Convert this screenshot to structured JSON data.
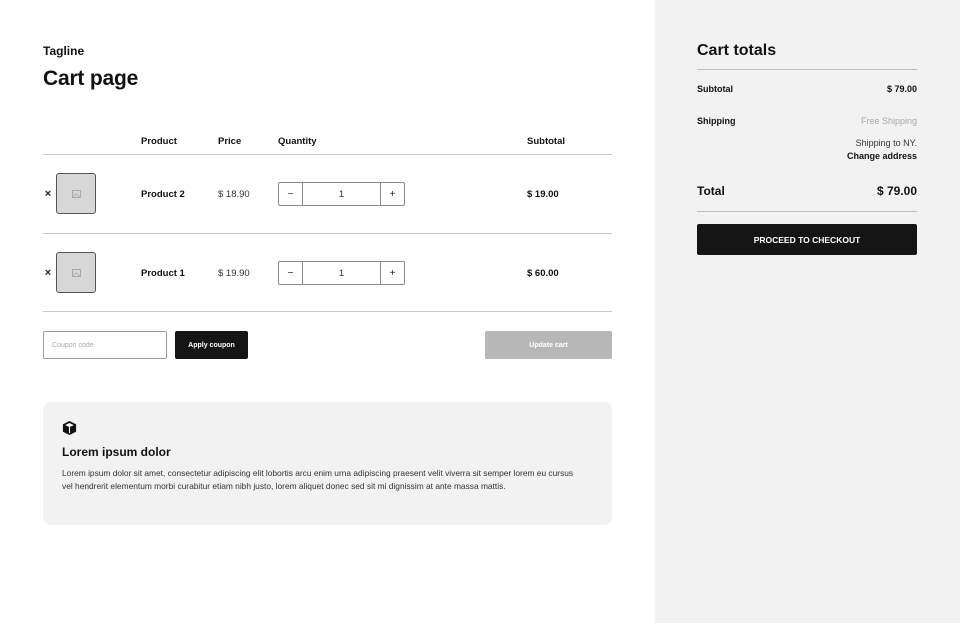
{
  "header": {
    "tagline": "Tagline",
    "title": "Cart page"
  },
  "table": {
    "columns": [
      "Product",
      "Price",
      "Quantity",
      "Subtotal"
    ],
    "rows": [
      {
        "remove": "×",
        "name": "Product 2",
        "price": "$ 18.90",
        "qty_minus": "−",
        "quantity": "1",
        "qty_plus": "+",
        "subtotal": "$ 19.00"
      },
      {
        "remove": "×",
        "name": "Product 1",
        "price": "$ 19.90",
        "qty_minus": "−",
        "quantity": "1",
        "qty_plus": "+",
        "subtotal": "$ 60.00"
      }
    ]
  },
  "coupon": {
    "placeholder": "Coupon code",
    "apply_label": "Apply coupon",
    "update_label": "Update cart"
  },
  "info_card": {
    "icon": "box-icon",
    "title": "Lorem ipsum dolor",
    "text": "Lorem ipsum dolor sit amet, consectetur adipiscing elit lobortis arcu enim urna adipiscing praesent velit viverra sit semper lorem eu cursus vel hendrerit elementum morbi curabitur etiam nibh justo, lorem aliquet donec sed sit mi dignissim at ante massa mattis."
  },
  "totals": {
    "title": "Cart totals",
    "subtotal_label": "Subtotal",
    "subtotal_value": "$ 79.00",
    "shipping_label": "Shipping",
    "shipping_method": "Free Shipping",
    "shipping_to": "Shipping to NY.",
    "change_address": "Change address",
    "total_label": "Total",
    "total_value": "$ 79.00",
    "checkout_label": "PROCEED TO CHECKOUT"
  },
  "colors": {
    "primary": "#151515",
    "panel": "#f2f2f2",
    "disabled": "#b7b7b7",
    "muted_text": "#a8a8a8"
  }
}
